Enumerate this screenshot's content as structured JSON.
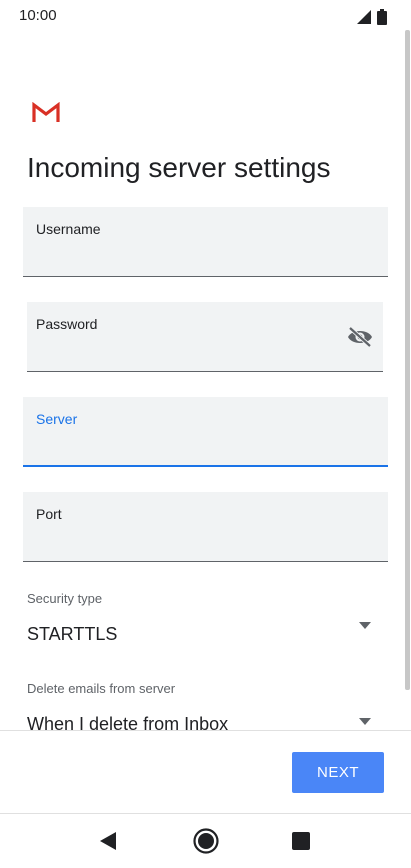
{
  "status_bar": {
    "time": "10:00",
    "icons": [
      "signal-icon",
      "battery-icon"
    ]
  },
  "app": {
    "logo": "gmail-logo",
    "title": "Incoming server settings"
  },
  "form": {
    "username": {
      "label": "Username",
      "value": ""
    },
    "password": {
      "label": "Password",
      "value": "",
      "visibility_icon": "eye-off-icon"
    },
    "server": {
      "label": "Server",
      "value": "",
      "focused": true
    },
    "port": {
      "label": "Port",
      "value": ""
    },
    "security_type": {
      "label": "Security type",
      "value": "STARTTLS"
    },
    "delete_emails": {
      "label": "Delete emails from server",
      "value": "When I delete from Inbox"
    }
  },
  "actions": {
    "next_label": "NEXT"
  },
  "navigation": {
    "buttons": [
      "back-icon",
      "home-icon",
      "recents-icon"
    ]
  },
  "colors": {
    "accent": "#1a73e8",
    "button": "#4a86f7",
    "field_bg": "#f1f3f4",
    "gmail_red": "#d93025"
  }
}
